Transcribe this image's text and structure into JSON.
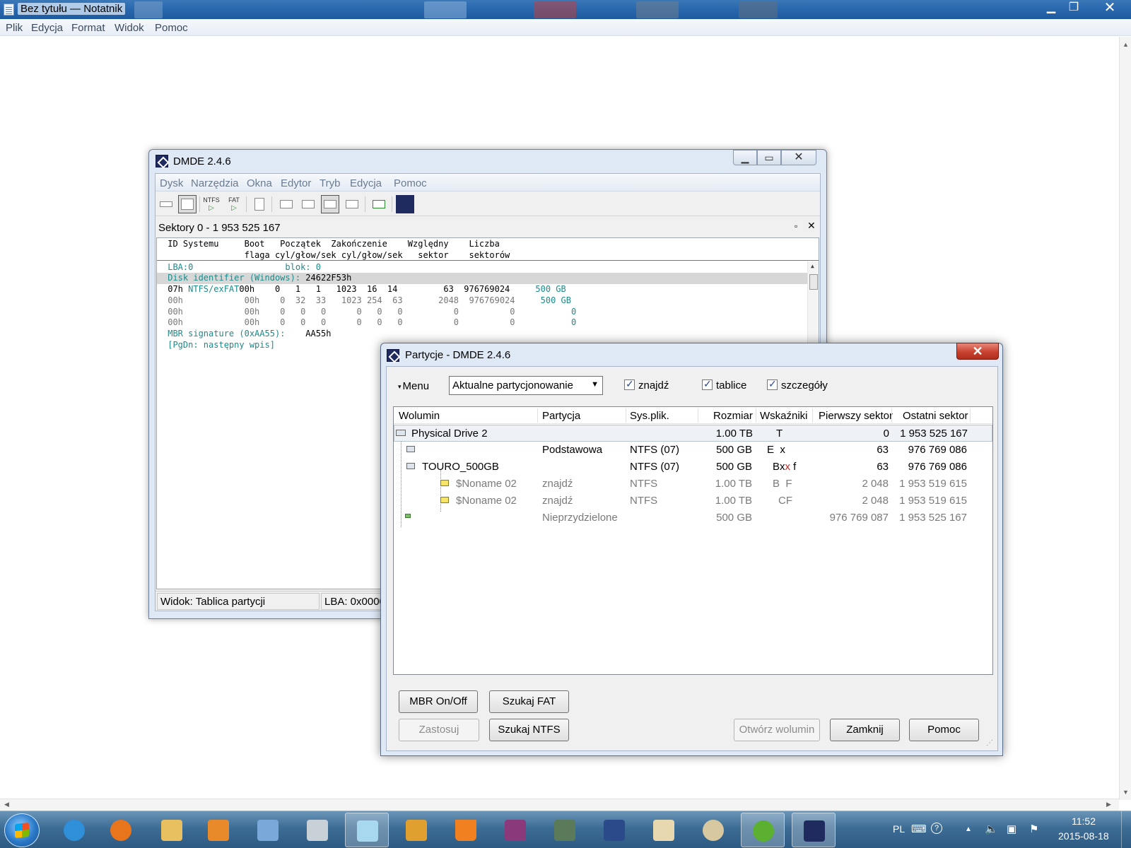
{
  "notepad": {
    "title": "Bez tytułu — Notatnik",
    "controls": {
      "minimize": "▁",
      "maximize": "❐",
      "close": "✕"
    },
    "menu": [
      "Plik",
      "Edycja",
      "Format",
      "Widok",
      "Pomoc"
    ],
    "scroll_arrows": {
      "up": "▲",
      "down": "▼",
      "left": "◀",
      "right": "▶"
    }
  },
  "dmde": {
    "title": "DMDE 2.4.6",
    "controls": {
      "minimize": "▁",
      "maximize": "▭",
      "close": "✕"
    },
    "menu": [
      "Dysk",
      "Narzędzia",
      "Okna",
      "Edytor",
      "Tryb",
      "Edycja",
      "Pomoc"
    ],
    "toolbar": {
      "ntfs_label": "NTFS",
      "fat_label": "FAT",
      "play": "▷"
    },
    "sectors_title": "Sektory 0 - 1 953 525 167",
    "panel_controls": {
      "maximize": "▫",
      "close": "✕"
    },
    "hex_header": [
      " ID Systemu     Boot   Początek  Zakończenie    Względny    Liczba",
      "                flaga cyl/głow/sek cyl/głow/sek   sektor    sektorów"
    ],
    "hex_lines": [
      {
        "text": " LBA:0                  blok: 0",
        "style": "teal"
      },
      {
        "text": " Disk identifier (Windows): ",
        "extra": "24622F53h",
        "style": "teal",
        "band": true
      },
      {
        "text": " 07h ",
        "mid": "NTFS/exFAT",
        "rest": "00h    0   1   1   1023  16  14         63  976769024     ",
        "tail": "500 GB",
        "style": "mixed"
      },
      {
        "text": " 00h            00h    0  32  33   1023 254  63       2048  976769024     ",
        "tail": "500 GB",
        "style": "gray"
      },
      {
        "text": " 00h            00h    0   0   0      0   0   0          0          0           ",
        "tail": "0",
        "style": "gray"
      },
      {
        "text": " 00h            00h    0   0   0      0   0   0          0          0           ",
        "tail": "0",
        "style": "gray"
      },
      {
        "text": " MBR signature (0xAA55):    ",
        "extra": "AA55h",
        "style": "teal"
      },
      {
        "text": " [PgDn: następny wpis]",
        "style": "teal"
      }
    ],
    "status": {
      "view": "Widok: Tablica partycji",
      "lba": "LBA: 0x0000"
    },
    "scroll_up": "▲"
  },
  "partitions": {
    "title": "Partycje - DMDE 2.4.6",
    "close": "✕",
    "menu_label": "Menu",
    "menu_caret": "▾",
    "mode": "Aktualne partycjonowanie",
    "mode_caret": "▼",
    "checks": {
      "find": "znajdź",
      "tables": "tablice",
      "details": "szczegóły"
    },
    "columns": [
      "Wolumin",
      "Partycja",
      "Sys.plik.",
      "Rozmiar",
      "Wskaźniki",
      "Pierwszy sektor",
      "Ostatni sektor"
    ],
    "rows": [
      {
        "volume": "Physical Drive 2",
        "partition": "",
        "fs": "",
        "size": "1.00 TB",
        "flags": "T",
        "first": "0",
        "last": "1 953 525 167"
      },
      {
        "volume": "",
        "partition": "Podstawowa",
        "fs": "NTFS (07)",
        "size": "500 GB",
        "flags": "E  x",
        "first": "63",
        "last": "976 769 086"
      },
      {
        "volume": "TOURO_500GB",
        "partition": "",
        "fs": "NTFS (07)",
        "size": "500 GB",
        "flags_a": "Bx",
        "flags_b": "x",
        "flags_c": " f",
        "first": "63",
        "last": "976 769 086"
      },
      {
        "volume": "$Noname 02",
        "partition": "znajdź",
        "fs": "NTFS",
        "size": "1.00 TB",
        "flags": "B  F",
        "first": "2 048",
        "last": "1 953 519 615"
      },
      {
        "volume": "$Noname 02",
        "partition": "znajdź",
        "fs": "NTFS",
        "size": "1.00 TB",
        "flags": "CF",
        "first": "2 048",
        "last": "1 953 519 615"
      },
      {
        "volume": "",
        "partition": "Nieprzydzielone",
        "fs": "",
        "size": "500 GB",
        "flags": "",
        "first": "976 769 087",
        "last": "1 953 525 167"
      }
    ],
    "buttons": {
      "mbr": "MBR On/Off",
      "search_fat": "Szukaj FAT",
      "apply": "Zastosuj",
      "search_ntfs": "Szukaj NTFS",
      "open_volume": "Otwórz wolumin",
      "close": "Zamknij",
      "help": "Pomoc"
    },
    "grip": "⋰"
  },
  "taskbar": {
    "lang": "PL",
    "time": "11:52",
    "date": "2015-08-18",
    "tray_icons": {
      "keyboard": "⌨",
      "help": "?",
      "chevron": "▲",
      "volume": "🔈",
      "network": "▣",
      "flag": "⚑"
    }
  },
  "colors": {
    "teal_text": "#1e8a8a",
    "close_red": "#c9422f",
    "taskbar": "#3d6c95",
    "flag_red": "#d62020"
  }
}
